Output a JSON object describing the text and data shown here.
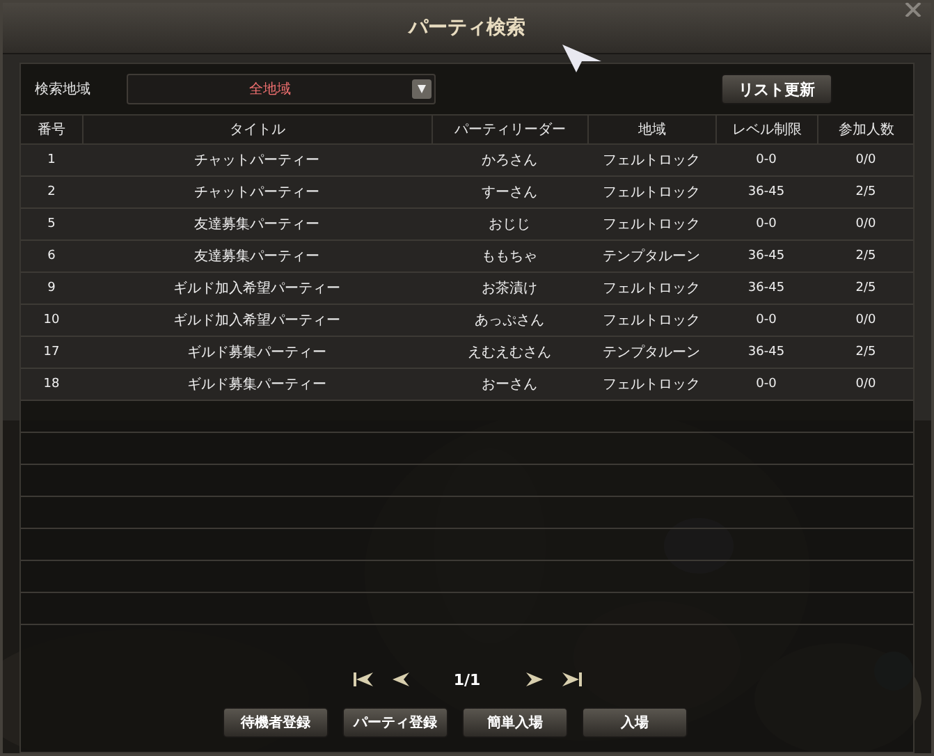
{
  "window": {
    "title": "パーティ検索"
  },
  "filter": {
    "label": "検索地域",
    "value": "全地域",
    "refresh_button": "リスト更新"
  },
  "table": {
    "columns": [
      "番号",
      "タイトル",
      "パーティリーダー",
      "地域",
      "レベル制限",
      "参加人数"
    ],
    "rows": [
      [
        "1",
        "チャットパーティー",
        "かろさん",
        "フェルトロック",
        "0-0",
        "0/0"
      ],
      [
        "2",
        "チャットパーティー",
        "すーさん",
        "フェルトロック",
        "36-45",
        "2/5"
      ],
      [
        "5",
        "友達募集パーティー",
        "おじじ",
        "フェルトロック",
        "0-0",
        "0/0"
      ],
      [
        "6",
        "友達募集パーティー",
        "ももちゃ",
        "テンプタルーン",
        "36-45",
        "2/5"
      ],
      [
        "9",
        "ギルド加入希望パーティー",
        "お茶漬け",
        "フェルトロック",
        "36-45",
        "2/5"
      ],
      [
        "10",
        "ギルド加入希望パーティー",
        "あっぷさん",
        "フェルトロック",
        "0-0",
        "0/0"
      ],
      [
        "17",
        "ギルド募集パーティー",
        "えむえむさん",
        "テンプタルーン",
        "36-45",
        "2/5"
      ],
      [
        "18",
        "ギルド募集パーティー",
        "おーさん",
        "フェルトロック",
        "0-0",
        "0/0"
      ]
    ]
  },
  "pagination": {
    "page": "1/1"
  },
  "buttons": [
    "待機者登録",
    "パーティ登録",
    "簡単入場",
    "入場"
  ]
}
